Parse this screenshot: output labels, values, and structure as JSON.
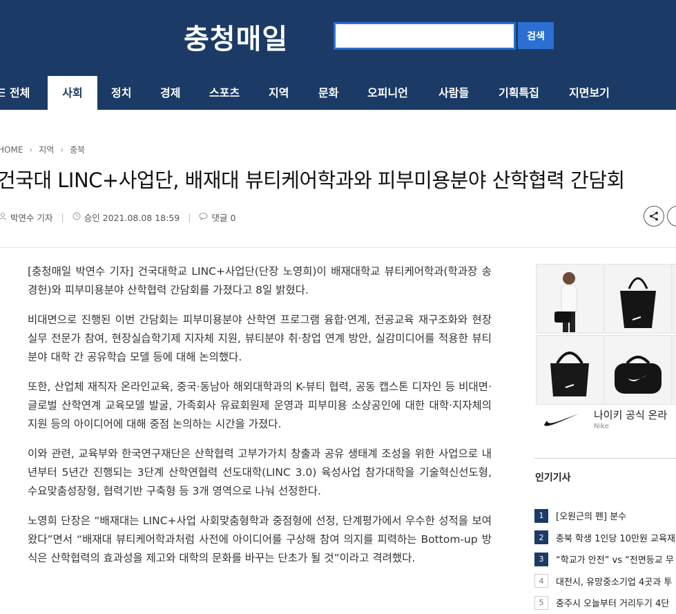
{
  "header": {
    "logo": "충청매일",
    "search_button": "검색",
    "search_value": ""
  },
  "nav": {
    "all": "☰ 전체",
    "items": [
      "사회",
      "정치",
      "경제",
      "스포츠",
      "지역",
      "문화",
      "오피니언",
      "사람들",
      "기획특집",
      "지면보기"
    ],
    "active": "사회"
  },
  "breadcrumb": [
    "HOME",
    "지역",
    "충북"
  ],
  "article": {
    "title": "건국대 LINC+사업단, 배재대 뷰티케어학과와 피부미용분야 산학협력 간담회",
    "reporter": "박연수 기자",
    "approved": "승인 2021.08.08 18:59",
    "comments": "댓글 0",
    "paragraphs": [
      "[충청매일 박연수 기자] 건국대학교 LINC+사업단(단장 노영희)이 배재대학교 뷰티케어학과(학과장 송경헌)와 피부미용분야 산학협력 간담회를 가졌다고 8일 밝혔다.",
      "비대면으로 진행된 이번 간담회는 피부미용분야 산학연 프로그램 융합·연계, 전공교육 재구조화와 현장실무 전문가 참여, 현장실습학기제 지자체 지원, 뷰티분야 취·창업 연계 방안, 실감미디어를 적용한 뷰티분야 대학 간 공유학습 모델 등에 대해 논의했다.",
      "또한, 산업체 재직자 온라인교육, 중국·동남아 해외대학과의 K-뷰티 협력, 공동 캡스톤 디자인 등 비대면·글로벌 산학연계 교육모델 발굴, 가족회사 유료회원제 운영과 피부미용 소상공인에 대한 대학·지자체의 지원 등의 아이디어에 대해 중점 논의하는 시간을 가졌다.",
      "이와 관련, 교육부와 한국연구재단은 산학협력 고부가가치 창출과 공유 생태계 조성을 위한 사업으로 내년부터 5년간 진행되는 3단계 산학연협력 선도대학(LINC 3.0) 육성사업 참가대학을 기술혁신선도형, 수요맞춤성장형, 협력기반 구축형 등 3개 영역으로 나눠 선정한다.",
      "노영희 단장은 “배재대는 LINC+사업 사회맞춤형학과 중점형에 선정, 단계평가에서 우수한 성적을 보여왔다”면서 “배재대 뷰티케어학과처럼 사전에 아이디어를 구상해 참여 의지를 피력하는 Bottom-up 방식은 산학협력의 효과성을 제고와 대학의 문화를 바꾸는 단초가 될 것”이라고 격려했다."
    ]
  },
  "ad": {
    "name": "나이키 공식 온라",
    "brand": "Nike"
  },
  "popular": {
    "title": "인기기사",
    "items": [
      {
        "rank": "1",
        "title": "[오원근의 펜] 분수"
      },
      {
        "rank": "2",
        "title": "충북 학생 1인당 10만원 교육재"
      },
      {
        "rank": "3",
        "title": "“학교가 안전” vs “전면등교 무"
      },
      {
        "rank": "4",
        "title": "대전시, 유망중소기업 4곳과 투"
      },
      {
        "rank": "5",
        "title": "충주시 오늘부터 거리두기 4단"
      }
    ]
  }
}
